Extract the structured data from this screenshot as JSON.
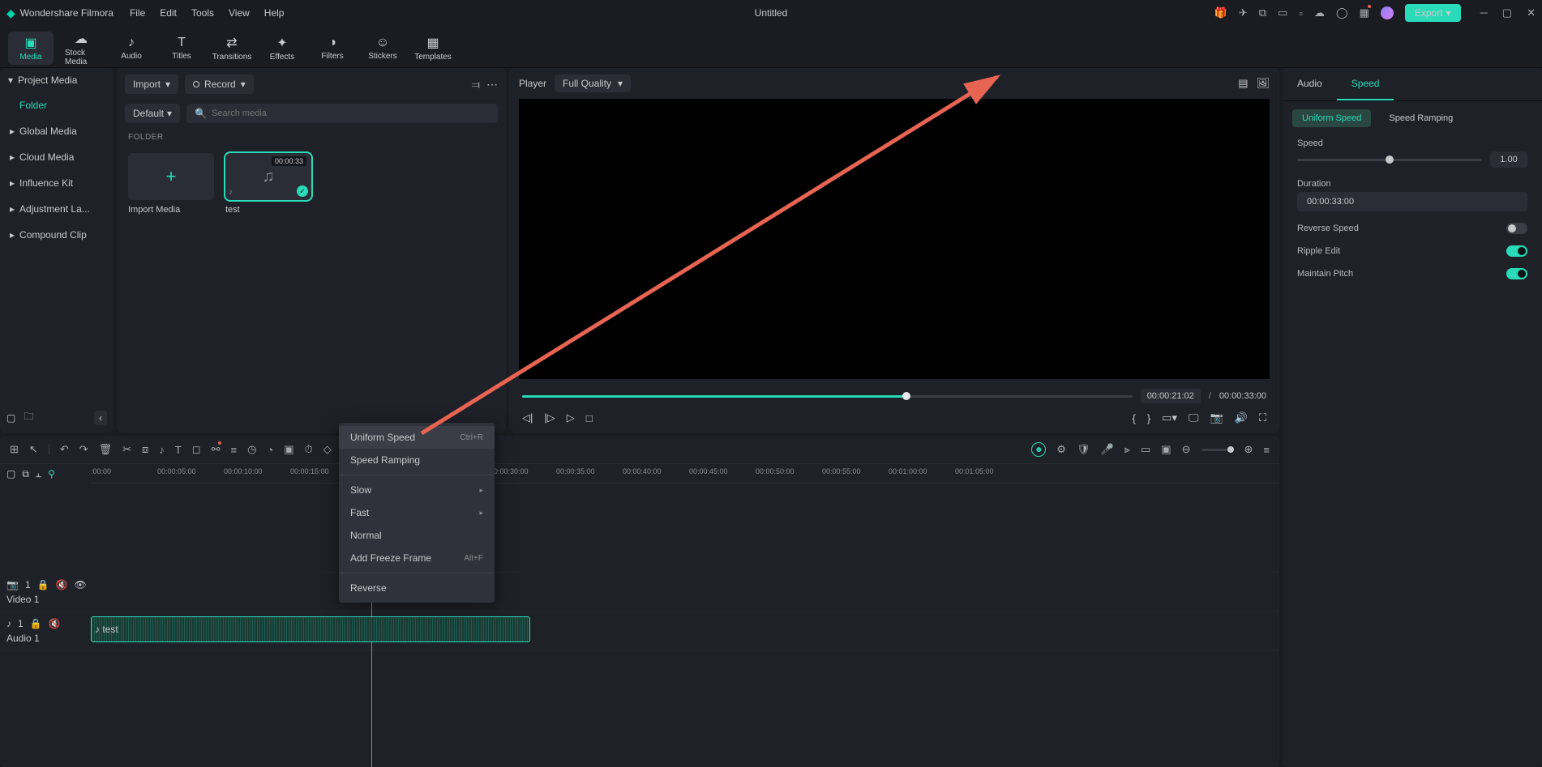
{
  "app_name": "Wondershare Filmora",
  "doc_title": "Untitled",
  "menu": [
    "File",
    "Edit",
    "Tools",
    "View",
    "Help"
  ],
  "export_label": "Export",
  "top_tabs": [
    {
      "label": "Media",
      "icon": "▣"
    },
    {
      "label": "Stock Media",
      "icon": "☁"
    },
    {
      "label": "Audio",
      "icon": "♪"
    },
    {
      "label": "Titles",
      "icon": "T"
    },
    {
      "label": "Transitions",
      "icon": "⇄"
    },
    {
      "label": "Effects",
      "icon": "✦"
    },
    {
      "label": "Filters",
      "icon": "◑"
    },
    {
      "label": "Stickers",
      "icon": "☺"
    },
    {
      "label": "Templates",
      "icon": "▦"
    }
  ],
  "sidebar": {
    "header": "Project Media",
    "folder": "Folder",
    "items": [
      "Global Media",
      "Cloud Media",
      "Influence Kit",
      "Adjustment La...",
      "Compound Clip"
    ]
  },
  "browser": {
    "import_label": "Import",
    "record_label": "Record",
    "sort_label": "Default",
    "search_placeholder": "Search media",
    "folder_label": "FOLDER",
    "import_card": "Import Media",
    "clip": {
      "name": "test",
      "duration": "00:00:33"
    }
  },
  "player": {
    "label": "Player",
    "quality": "Full Quality",
    "current": "00:00:21:02",
    "total": "00:00:33:00"
  },
  "inspector": {
    "tabs": [
      "Audio",
      "Speed"
    ],
    "sub_tabs": [
      "Uniform Speed",
      "Speed Ramping"
    ],
    "speed_label": "Speed",
    "speed_value": "1.00",
    "duration_label": "Duration",
    "duration_value": "00:00:33:00",
    "reverse_label": "Reverse Speed",
    "ripple_label": "Ripple Edit",
    "pitch_label": "Maintain Pitch"
  },
  "timeline": {
    "ruler": [
      ":00:00",
      "00:00:05:00",
      "00:00:10:00",
      "00:00:15:00",
      "00:00:30:00",
      "00:00:35:00",
      "00:00:40:00",
      "00:00:45:00",
      "00:00:50:00",
      "00:00:55:00",
      "00:01:00:00",
      "00:01:05:00"
    ],
    "video_track": "Video 1",
    "audio_track": "Audio 1",
    "clip_name": "test"
  },
  "context_menu": {
    "items": [
      {
        "label": "Uniform Speed",
        "shortcut": "Ctrl+R",
        "hl": true
      },
      {
        "label": "Speed Ramping"
      },
      {
        "sep": true
      },
      {
        "label": "Slow",
        "sub": true
      },
      {
        "label": "Fast",
        "sub": true
      },
      {
        "label": "Normal"
      },
      {
        "label": "Add Freeze Frame",
        "shortcut": "Alt+F"
      },
      {
        "sep": true
      },
      {
        "label": "Reverse"
      }
    ]
  }
}
